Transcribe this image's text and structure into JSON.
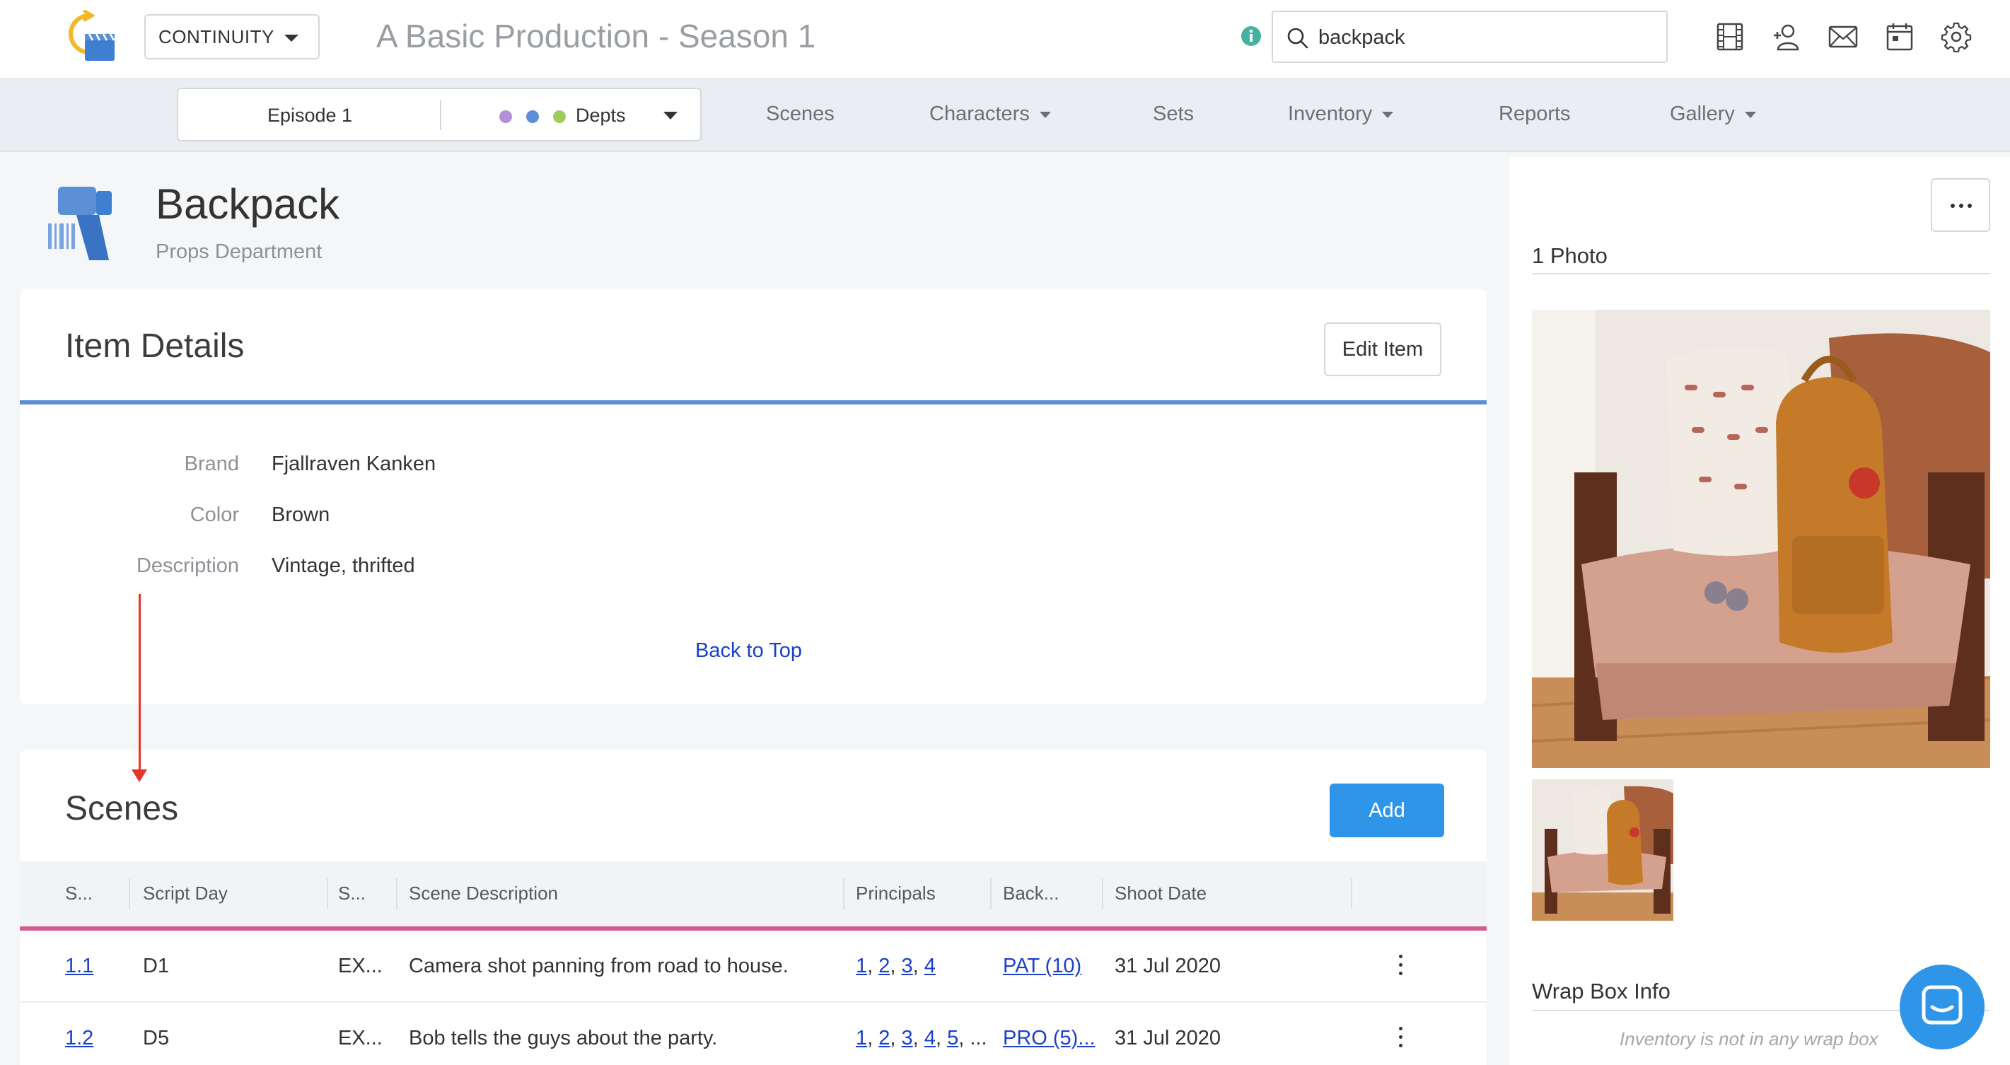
{
  "app": {
    "module_select": "CONTINUITY",
    "production_title": "A Basic Production - Season 1"
  },
  "search": {
    "value": "backpack"
  },
  "nav": {
    "episode": "Episode 1",
    "departments_label": "Depts",
    "department_dot_colors": [
      "#b38fd8",
      "#5b8fd6",
      "#9ccc5a"
    ],
    "items": [
      {
        "label": "Scenes"
      },
      {
        "label": "Characters",
        "dropdown": true
      },
      {
        "label": "Sets"
      },
      {
        "label": "Inventory",
        "dropdown": true
      },
      {
        "label": "Reports"
      },
      {
        "label": "Gallery",
        "dropdown": true
      }
    ]
  },
  "item": {
    "title": "Backpack",
    "department": "Props Department"
  },
  "details": {
    "heading": "Item Details",
    "edit_button": "Edit Item",
    "fields": [
      {
        "label": "Brand",
        "value": "Fjallraven Kanken"
      },
      {
        "label": "Color",
        "value": "Brown"
      },
      {
        "label": "Description",
        "value": "Vintage, thrifted"
      }
    ],
    "back_to_top": "Back to Top"
  },
  "scenes": {
    "heading": "Scenes",
    "add_button": "Add",
    "columns": [
      "S...",
      "Script Day",
      "S...",
      "Scene Description",
      "Principals",
      "Back...",
      "Shoot Date"
    ],
    "rows": [
      {
        "scene": "1.1",
        "script_day": "D1",
        "set": "EX...",
        "description": "Camera shot panning from road to house.",
        "principals": [
          "1",
          "2",
          "3",
          "4"
        ],
        "principals_overflow": "",
        "background": "PAT (10)",
        "shoot_date": "31 Jul 2020"
      },
      {
        "scene": "1.2",
        "script_day": "D5",
        "set": "EX...",
        "description": "Bob tells the guys about the party.",
        "principals": [
          "1",
          "2",
          "3",
          "4",
          "5"
        ],
        "principals_overflow": "...",
        "background": "PRO (5)...",
        "shoot_date": "31 Jul 2020"
      }
    ]
  },
  "side": {
    "photos_heading": "1 Photo",
    "wrap_box_heading": "Wrap Box Info",
    "wrap_box_empty": "Inventory is not in any wrap box"
  },
  "colors": {
    "accent_blue": "#2f95e8",
    "details_rule": "#5b8fd6",
    "scenes_rule": "#d65a8f",
    "link": "#1a3fcb",
    "annotation": "#e8332a"
  }
}
